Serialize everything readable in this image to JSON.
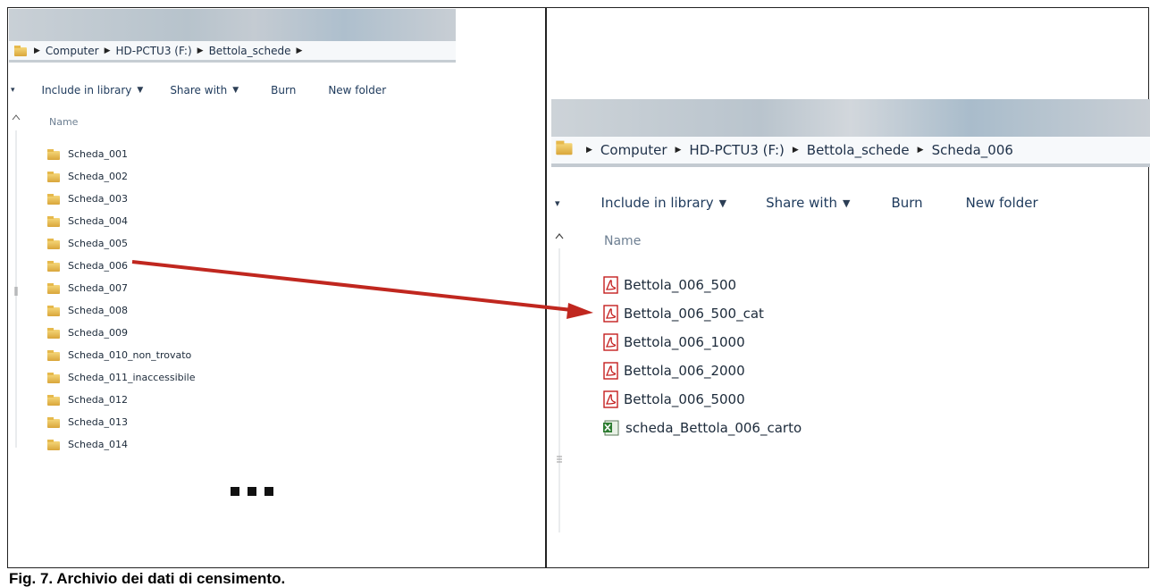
{
  "left_window": {
    "breadcrumb": [
      "Computer",
      "HD-PCTU3 (F:)",
      "Bettola_schede"
    ],
    "toolbar": {
      "include": "Include in library",
      "share": "Share with",
      "burn": "Burn",
      "new_folder": "New folder"
    },
    "column_header": "Name",
    "folders": [
      "Scheda_001",
      "Scheda_002",
      "Scheda_003",
      "Scheda_004",
      "Scheda_005",
      "Scheda_006",
      "Scheda_007",
      "Scheda_008",
      "Scheda_009",
      "Scheda_010_non_trovato",
      "Scheda_011_inaccessibile",
      "Scheda_012",
      "Scheda_013",
      "Scheda_014"
    ],
    "ellipsis": "..."
  },
  "right_window": {
    "breadcrumb": [
      "Computer",
      "HD-PCTU3 (F:)",
      "Bettola_schede",
      "Scheda_006"
    ],
    "toolbar": {
      "include": "Include in library",
      "share": "Share with",
      "burn": "Burn",
      "new_folder": "New folder"
    },
    "column_header": "Name",
    "files": [
      {
        "name": "Bettola_006_500",
        "icon": "pdf-icon"
      },
      {
        "name": "Bettola_006_500_cat",
        "icon": "pdf-icon"
      },
      {
        "name": "Bettola_006_1000",
        "icon": "pdf-icon"
      },
      {
        "name": "Bettola_006_2000",
        "icon": "pdf-icon"
      },
      {
        "name": "Bettola_006_5000",
        "icon": "pdf-icon"
      },
      {
        "name": "scheda_Bettola_006_carto",
        "icon": "excel-icon"
      }
    ]
  },
  "arrow": {
    "from": "Scheda_006",
    "to": "Bettola_006_500_cat",
    "color": "#c0271f"
  },
  "caption": "Fig. 7. Archivio dei dati di censimento.",
  "colors": {
    "folder": "#e6b94c",
    "pdf": "#c41e1e",
    "excel": "#2e7d32",
    "link_text": "#1e3a5c"
  }
}
